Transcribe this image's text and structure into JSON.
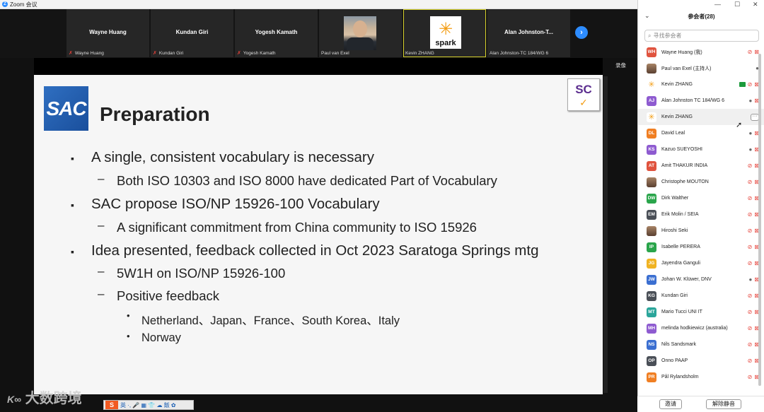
{
  "window": {
    "title": "Zoom 会议",
    "logo": "Z"
  },
  "strip": {
    "tiles": [
      {
        "name": "Wayne Huang",
        "label": "Wayne Huang",
        "muted": true
      },
      {
        "name": "Kundan Giri",
        "label": "Kundan Giri",
        "muted": true
      },
      {
        "name": "Yogesh Kamath",
        "label": "Yogesh Kamath",
        "muted": true
      },
      {
        "name": "",
        "label": "Paul van Exel",
        "muted": false
      },
      {
        "name": "",
        "label": "Kevin ZHANG",
        "muted": false
      },
      {
        "name": "Alan Johnston-T...",
        "label": "Alan Johnston-TC 184/WG 6",
        "muted": false
      }
    ],
    "spark_text": "spark",
    "next_icon": "›"
  },
  "share": {
    "record_label": "录像"
  },
  "slide": {
    "logo_left": "SAC",
    "logo_right": "SC",
    "logo_right_mark": "✓",
    "title": "Preparation",
    "bullets": {
      "l1_a": "A single, consistent vocabulary is necessary",
      "l2_a": "Both ISO 10303 and ISO 8000 have dedicated Part of Vocabulary",
      "l1_b": "SAC propose ISO/NP 15926-100 Vocabulary",
      "l2_b": "A significant commitment from China community to ISO 15926",
      "l1_c": "Idea presented, feedback collected in Oct 2023 Saratoga Springs mtg",
      "l2_c1": "5W1H on ISO/NP 15926-100",
      "l2_c2": "Positive feedback",
      "l3_c1": "Netherland、Japan、France、South Korea、Italy",
      "l3_c2": "Norway"
    },
    "bullet_l1": "▪",
    "bullet_l2": "–",
    "bullet_l3": "•"
  },
  "overlay": {
    "watermark": "大数跨境",
    "ime_logo": "S",
    "ime_text": "英 ·, 🎤 ▦ 👕 ☁ 飯 ✿"
  },
  "panel": {
    "title": "参会者(28)",
    "search_placeholder": "寻找参会者",
    "controls": {
      "min": "—",
      "max": "☐",
      "close": "✕"
    },
    "participants": [
      {
        "initials": "WH",
        "name": "Wayne Huang (我)",
        "color": "#e0533e",
        "mic": "off",
        "cam": "off"
      },
      {
        "initials": "",
        "name": "Paul van Exel (主持人)",
        "color": "",
        "photo": true,
        "mic": "on",
        "cam": "none"
      },
      {
        "initials": "",
        "name": "Kevin ZHANG",
        "color": "",
        "spark": true,
        "mic": "off",
        "cam": "off",
        "share": true
      },
      {
        "initials": "AJ",
        "name": "Alan Johnston TC 184/WG 6",
        "color": "#8e5bd0",
        "mic": "on",
        "cam": "off"
      },
      {
        "initials": "",
        "name": "Kevin ZHANG",
        "color": "",
        "spark": true,
        "mic": "none",
        "cam": "none",
        "hover": true,
        "more": "···"
      },
      {
        "initials": "DL",
        "name": "David Leal",
        "color": "#f07f23",
        "mic": "on",
        "cam": "off"
      },
      {
        "initials": "KS",
        "name": "Kazuo SUEYOSHI",
        "color": "#8e5bd0",
        "mic": "on",
        "cam": "off"
      },
      {
        "initials": "AT",
        "name": "Amit THAKUR INDIA",
        "color": "#e0533e",
        "mic": "off",
        "cam": "off"
      },
      {
        "initials": "",
        "name": "Christophe MOUTON",
        "color": "",
        "photo": true,
        "mic": "off",
        "cam": "off"
      },
      {
        "initials": "DW",
        "name": "Dirk Walther",
        "color": "#2aa54b",
        "mic": "off",
        "cam": "off"
      },
      {
        "initials": "EM",
        "name": "Erik Molin / SEIA",
        "color": "#4a4f57",
        "mic": "off",
        "cam": "off"
      },
      {
        "initials": "",
        "name": "Hiroshi Seki",
        "color": "",
        "photo": true,
        "mic": "off",
        "cam": "off"
      },
      {
        "initials": "IP",
        "name": "Isabelle PERERA",
        "color": "#2aa54b",
        "mic": "off",
        "cam": "off"
      },
      {
        "initials": "JG",
        "name": "Jayendra Ganguli",
        "color": "#f0b323",
        "mic": "off",
        "cam": "off"
      },
      {
        "initials": "JW",
        "name": "Johan W. Klüwer, DNV",
        "color": "#3b6fd1",
        "mic": "on",
        "cam": "off"
      },
      {
        "initials": "KG",
        "name": "Kundan Giri",
        "color": "#4a4f57",
        "mic": "off",
        "cam": "off"
      },
      {
        "initials": "MT",
        "name": "Mario Tucci UNI IT",
        "color": "#2aa59a",
        "mic": "off",
        "cam": "off"
      },
      {
        "initials": "MH",
        "name": "melinda hodkiewicz (australia)",
        "color": "#8e5bd0",
        "mic": "off",
        "cam": "off"
      },
      {
        "initials": "NS",
        "name": "Nils Sandsmark",
        "color": "#3b6fd1",
        "mic": "off",
        "cam": "off"
      },
      {
        "initials": "OP",
        "name": "Onno PAAP",
        "color": "#4a4f57",
        "mic": "off",
        "cam": "off"
      },
      {
        "initials": "PR",
        "name": "Pål Rylandsholm",
        "color": "#f07f23",
        "mic": "off",
        "cam": "off"
      }
    ],
    "footer": {
      "invite": "邀请",
      "unmute_all": "解除静音"
    }
  }
}
